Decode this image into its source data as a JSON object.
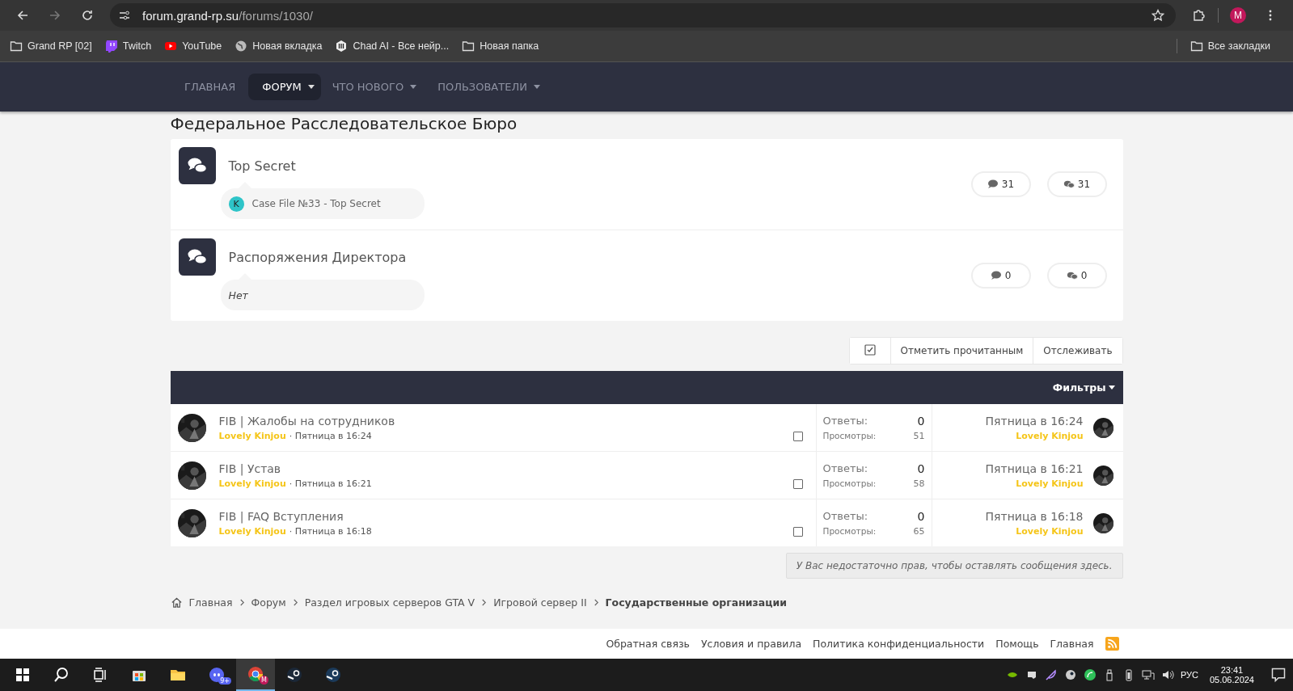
{
  "browser": {
    "url_host": "forum.grand-rp.su",
    "url_path": "/forums/1030/",
    "profile_initial": "M"
  },
  "bookmarks": [
    {
      "label": "Grand RP [02]",
      "kind": "folder"
    },
    {
      "label": "Twitch",
      "kind": "twitch"
    },
    {
      "label": "YouTube",
      "kind": "youtube"
    },
    {
      "label": "Новая вкладка",
      "kind": "globe"
    },
    {
      "label": "Chad AI - Все нейр...",
      "kind": "chad"
    },
    {
      "label": "Новая папка",
      "kind": "folder"
    }
  ],
  "all_bookmarks": "Все закладки",
  "nav": [
    {
      "label": "ГЛАВНАЯ",
      "selected": false,
      "dropdown": false
    },
    {
      "label": "ФОРУМ",
      "selected": true,
      "dropdown": true
    },
    {
      "label": "ЧТО НОВОГО",
      "selected": false,
      "dropdown": true
    },
    {
      "label": "ПОЛЬЗОВАТЕЛИ",
      "selected": false,
      "dropdown": true
    }
  ],
  "page_title": "Федеральное Расследовательское Бюро",
  "forums": [
    {
      "title": "Top Secret",
      "last_post": "Case File №33 - Top Secret",
      "last_initial": "K",
      "color": "#2ec4c8",
      "threads": "31",
      "messages": "31"
    },
    {
      "title": "Распоряжения Директора",
      "last_post": "Нет",
      "threads": "0",
      "messages": "0"
    }
  ],
  "actions": [
    "Отметить прочитанным",
    "Отслеживать"
  ],
  "filters": "Фильтры",
  "threads": [
    {
      "title": "FIB | Жалобы на сотрудников",
      "author": "Lovely Kinjou",
      "date": "· Пятница в 16:24",
      "checked": false,
      "replies_label": "Ответы:",
      "replies": "0",
      "views_label": "Просмотры:",
      "views": "51",
      "last_date": "Пятница в 16:24",
      "last_user": "Lovely Kinjou"
    },
    {
      "title": "FIB | Устав",
      "author": "Lovely Kinjou",
      "date": "· Пятница в 16:21",
      "checked": false,
      "replies_label": "Ответы:",
      "replies": "0",
      "views_label": "Просмотры:",
      "views": "58",
      "last_date": "Пятница в 16:21",
      "last_user": "Lovely Kinjou"
    },
    {
      "title": "FIB | FAQ Вступления",
      "author": "Lovely Kinjou",
      "date": "· Пятница в 16:18",
      "checked": false,
      "replies_label": "Ответы:",
      "replies": "0",
      "views_label": "Просмотры:",
      "views": "65",
      "last_date": "Пятница в 16:18",
      "last_user": "Lovely Kinjou"
    }
  ],
  "notice": "У Вас недостаточно прав, чтобы оставлять сообщения здесь.",
  "breadcrumb": [
    "Главная",
    "Форум",
    "Раздел игровых серверов GTA V",
    "Игровой сервер II",
    "Государственные организации"
  ],
  "footer_links": [
    "Обратная связь",
    "Условия и правила",
    "Политика конфиденциальности",
    "Помощь",
    "Главная"
  ],
  "taskbar": {
    "discord_badge": "9+",
    "chrome_initial": "M",
    "language": "РУС",
    "time": "23:41",
    "date": "05.06.2024"
  }
}
